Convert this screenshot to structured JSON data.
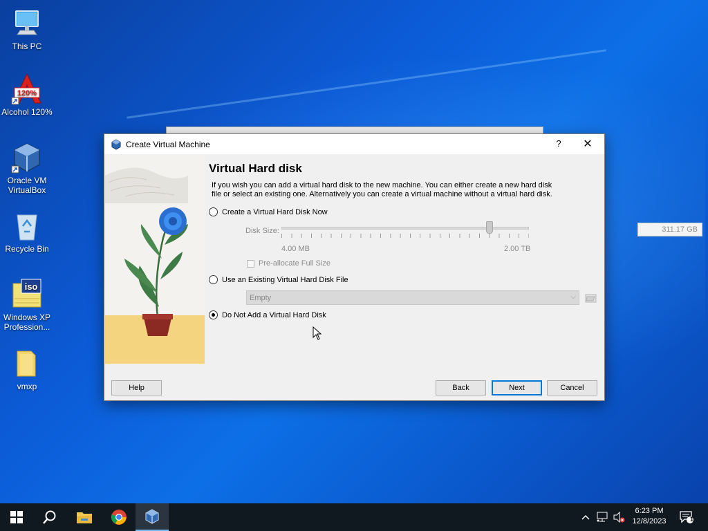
{
  "desktop": {
    "icons": [
      {
        "label": "This PC",
        "icon": "this-pc-icon"
      },
      {
        "label": "Alcohol 120%",
        "icon": "alcohol-icon",
        "badge": "120%"
      },
      {
        "label": "Oracle VM VirtualBox",
        "icon": "virtualbox-icon"
      },
      {
        "label": "Recycle Bin",
        "icon": "recycle-bin-icon"
      },
      {
        "label": "Windows XP Profession...",
        "icon": "iso-file-icon",
        "badge": "iso"
      },
      {
        "label": "vmxp",
        "icon": "folder-icon"
      }
    ]
  },
  "dialog": {
    "title": "Create Virtual Machine",
    "help_glyph": "?",
    "close_glyph": "✕",
    "heading": "Virtual Hard disk",
    "description": "If you wish you can add a virtual hard disk to the new machine. You can either create a new hard disk file or select an existing one. Alternatively you can create a virtual machine without a virtual hard disk.",
    "options": {
      "create_now": {
        "label": "Create a Virtual Hard Disk Now",
        "checked": false
      },
      "use_existing": {
        "label": "Use an Existing Virtual Hard Disk File",
        "checked": false
      },
      "do_not_add": {
        "label": "Do Not Add a Virtual Hard Disk",
        "checked": true
      }
    },
    "disk_size": {
      "label": "Disk Size:",
      "value": "311.17 GB",
      "min_label": "4.00 MB",
      "max_label": "2.00 TB",
      "slider_fraction": 0.84,
      "enabled": false
    },
    "preallocate": {
      "label": "Pre-allocate Full Size",
      "checked": false,
      "enabled": false
    },
    "existing_file": {
      "selected": "Empty",
      "enabled": false
    },
    "buttons": {
      "help": "Help",
      "back": "Back",
      "next": "Next",
      "cancel": "Cancel"
    }
  },
  "taskbar": {
    "clock_time": "6:23 PM",
    "clock_date": "12/8/2023",
    "notification_count": "1",
    "pinned": [
      "start-icon",
      "search-icon",
      "file-explorer-icon",
      "chrome-icon",
      "virtualbox-icon"
    ]
  },
  "colors": {
    "accent": "#0078d7",
    "taskbar": "#101820",
    "dialog_bg": "#f0f0f0"
  }
}
